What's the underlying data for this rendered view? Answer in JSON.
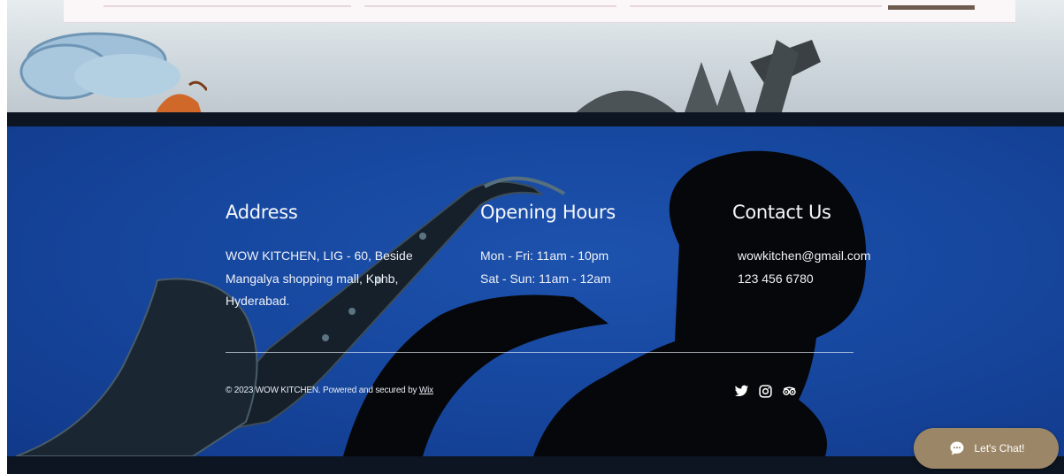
{
  "hero": {
    "brand_color": "#6e5a4e"
  },
  "footer": {
    "address": {
      "heading": "Address",
      "lines": [
        "WOW KITCHEN, LIG - 60, Beside",
        "Mangalya shopping mall, Kphb,",
        "Hyderabad."
      ]
    },
    "hours": {
      "heading": "Opening Hours",
      "lines": [
        "Mon - Fri: 11am - 10pm",
        "Sat - Sun: 11am - 12am"
      ]
    },
    "contact": {
      "heading": "Contact Us",
      "email": "wowkitchen@gmail.com",
      "phone": "123 456 6780"
    },
    "copyright": {
      "text": "© 2023 WOW KITCHEN. Powered and secured by ",
      "link_label": "Wix"
    },
    "socials": [
      {
        "icon": "twitter-icon"
      },
      {
        "icon": "instagram-icon"
      },
      {
        "icon": "tripadvisor-icon"
      }
    ]
  },
  "chat": {
    "label": "Let's Chat!",
    "color": "#9b8767"
  },
  "colors": {
    "footer_blue": "#1748a0",
    "footer_dark": "#0c1521"
  }
}
